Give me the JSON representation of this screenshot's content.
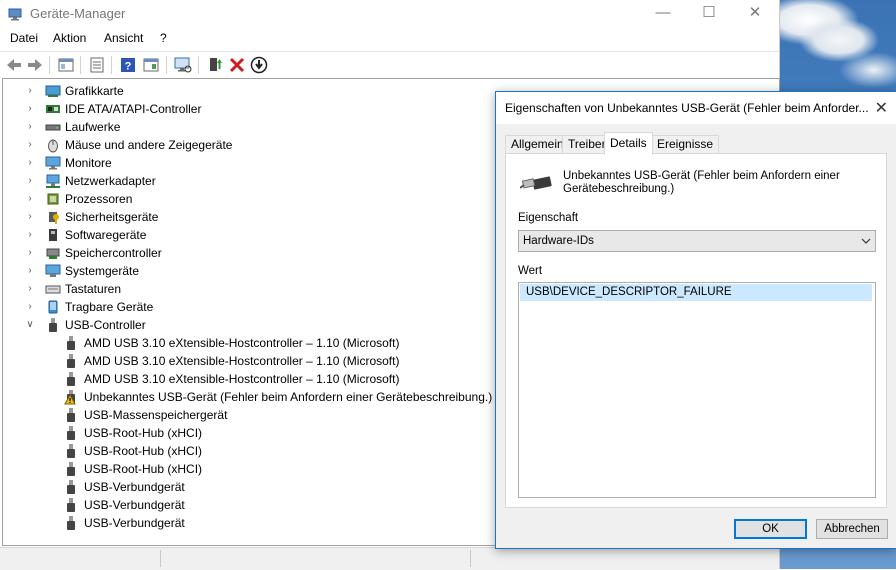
{
  "window": {
    "title": "Geräte-Manager",
    "minimize_glyph": "—",
    "maximize_glyph": "☐",
    "close_glyph": "✕"
  },
  "menu": {
    "items": [
      "Datei",
      "Aktion",
      "Ansicht",
      "?"
    ]
  },
  "tree": {
    "categories": [
      {
        "label": "Grafikkarte",
        "icon": "display-adapter-icon"
      },
      {
        "label": "IDE ATA/ATAPI-Controller",
        "icon": "ide-controller-icon"
      },
      {
        "label": "Laufwerke",
        "icon": "disk-drive-icon"
      },
      {
        "label": "Mäuse und andere Zeigegeräte",
        "icon": "mouse-icon"
      },
      {
        "label": "Monitore",
        "icon": "monitor-icon"
      },
      {
        "label": "Netzwerkadapter",
        "icon": "network-adapter-icon"
      },
      {
        "label": "Prozessoren",
        "icon": "processor-icon"
      },
      {
        "label": "Sicherheitsgeräte",
        "icon": "security-device-icon"
      },
      {
        "label": "Softwaregeräte",
        "icon": "software-device-icon"
      },
      {
        "label": "Speichercontroller",
        "icon": "storage-controller-icon"
      },
      {
        "label": "Systemgeräte",
        "icon": "system-device-icon"
      },
      {
        "label": "Tastaturen",
        "icon": "keyboard-icon"
      },
      {
        "label": "Tragbare Geräte",
        "icon": "portable-device-icon"
      },
      {
        "label": "USB-Controller",
        "icon": "usb-controller-icon"
      }
    ],
    "usb_children": [
      {
        "label": "AMD USB 3.10 eXtensible-Hostcontroller – 1.10 (Microsoft)",
        "warning": false
      },
      {
        "label": "AMD USB 3.10 eXtensible-Hostcontroller – 1.10 (Microsoft)",
        "warning": false
      },
      {
        "label": "AMD USB 3.10 eXtensible-Hostcontroller – 1.10 (Microsoft)",
        "warning": false
      },
      {
        "label": "Unbekanntes USB-Gerät (Fehler beim Anfordern einer Gerätebeschreibung.)",
        "warning": true
      },
      {
        "label": "USB-Massenspeichergerät",
        "warning": false
      },
      {
        "label": "USB-Root-Hub (xHCI)",
        "warning": false
      },
      {
        "label": "USB-Root-Hub (xHCI)",
        "warning": false
      },
      {
        "label": "USB-Root-Hub (xHCI)",
        "warning": false
      },
      {
        "label": "USB-Verbundgerät",
        "warning": false
      },
      {
        "label": "USB-Verbundgerät",
        "warning": false
      },
      {
        "label": "USB-Verbundgerät",
        "warning": false
      }
    ]
  },
  "dialog": {
    "title": "Eigenschaften von Unbekanntes USB-Gerät (Fehler beim Anforder...",
    "close_glyph": "✕",
    "tabs": [
      "Allgemein",
      "Treiber",
      "Details",
      "Ereignisse"
    ],
    "active_tab": "Details",
    "device_name": "Unbekanntes USB-Gerät (Fehler beim Anfordern einer Gerätebeschreibung.)",
    "property_label": "Eigenschaft",
    "property_value": "Hardware-IDs",
    "value_label": "Wert",
    "values": [
      "USB\\DEVICE_DESCRIPTOR_FAILURE"
    ],
    "ok_label": "OK",
    "cancel_label": "Abbrechen"
  },
  "colors": {
    "accent": "#0078d7",
    "selection": "#cce8ff",
    "warning": "#f2c200"
  }
}
